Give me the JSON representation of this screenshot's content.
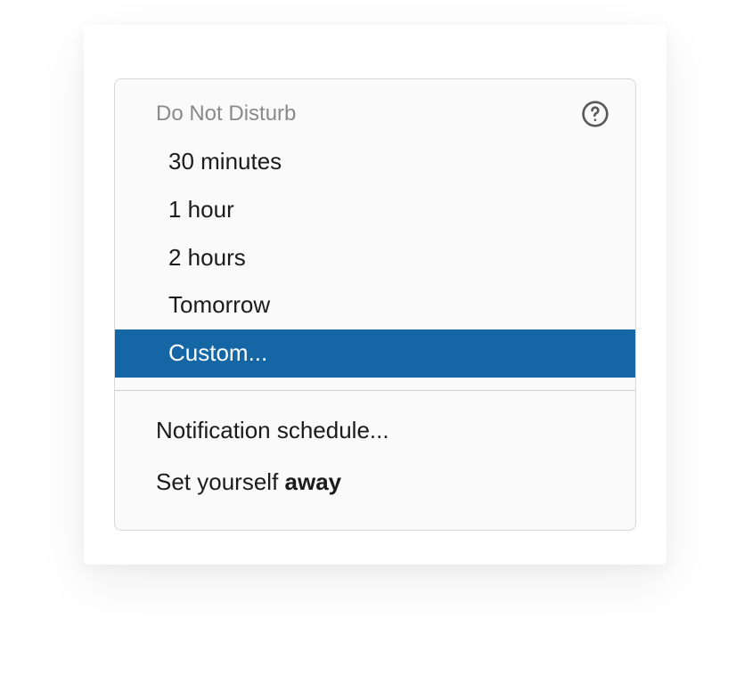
{
  "menu": {
    "title": "Do Not Disturb",
    "help_icon": "help-circle-icon",
    "options": [
      {
        "label": "30 minutes",
        "selected": false
      },
      {
        "label": "1 hour",
        "selected": false
      },
      {
        "label": "2 hours",
        "selected": false
      },
      {
        "label": "Tomorrow",
        "selected": false
      },
      {
        "label": "Custom...",
        "selected": true
      }
    ],
    "secondary": {
      "notification_schedule": "Notification schedule...",
      "set_away_prefix": "Set yourself ",
      "set_away_bold": "away"
    }
  },
  "colors": {
    "selected_bg": "#1466a5",
    "panel_bg": "#fafafa",
    "border": "#d8d8d8",
    "title_muted": "#8a8a8a",
    "text": "#1b1b1b"
  }
}
